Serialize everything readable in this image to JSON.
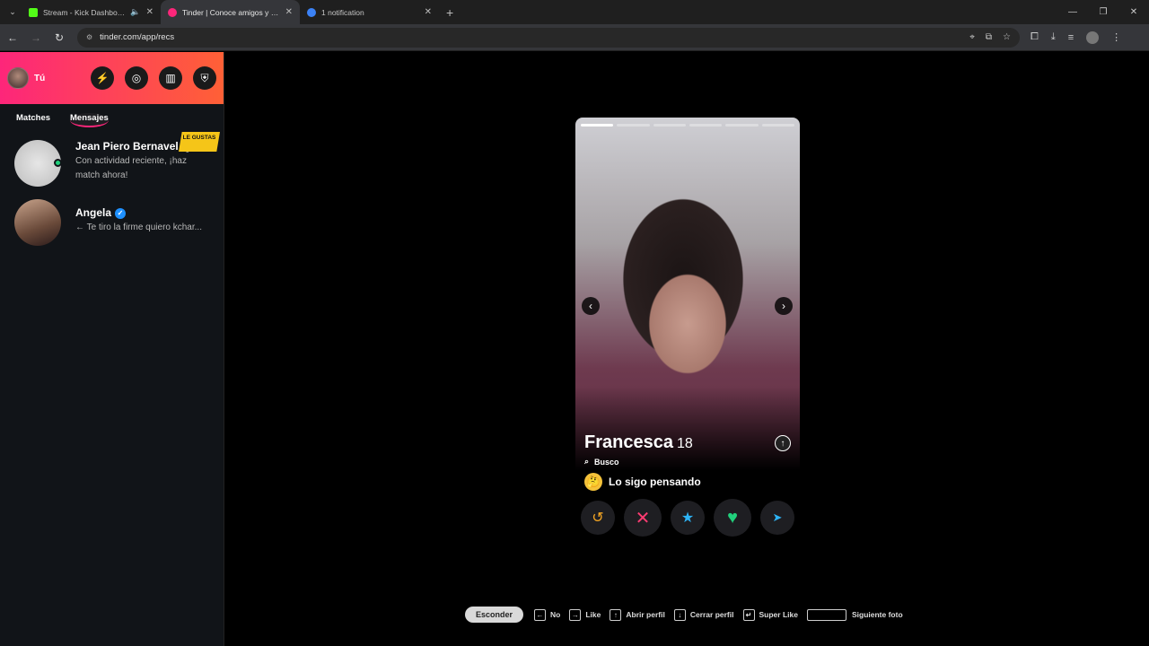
{
  "browser": {
    "tabs": [
      {
        "title": "Stream - Kick Dashboard",
        "color": "#53fc18"
      },
      {
        "title": "Tinder | Conoce amigos y gente",
        "color": "#fd267a"
      },
      {
        "title": "1 notification",
        "color": "#3b82f6"
      }
    ],
    "url": "tinder.com/app/recs"
  },
  "sidebar": {
    "user_name": "Tú",
    "tabs": [
      "Matches",
      "Mensajes"
    ],
    "messages": [
      {
        "name": "Jean Piero Bernavel Qu",
        "preview": "Con actividad reciente, ¡haz match ahora!",
        "badge": "LE GUSTAS"
      },
      {
        "name": "Angela",
        "preview": "← Te tiro la firme quiero kchar..."
      }
    ]
  },
  "card": {
    "name": "Francesca",
    "age": "18",
    "looking_label": "Busco",
    "goal": "Lo sigo pensando",
    "photo_count": 6,
    "active_photo": 1
  },
  "hints": {
    "hide": "Esconder",
    "no": "No",
    "like": "Like",
    "open": "Abrir perfil",
    "close": "Cerrar perfil",
    "super": "Super Like",
    "next": "Siguiente foto"
  },
  "colors": {
    "brand_start": "#fd267a",
    "brand_end": "#ff6036",
    "rewind": "#f5a623",
    "nope": "#fe3c72",
    "superlike": "#2db3f5",
    "like": "#21d07c",
    "boost": "#2db3f5"
  }
}
